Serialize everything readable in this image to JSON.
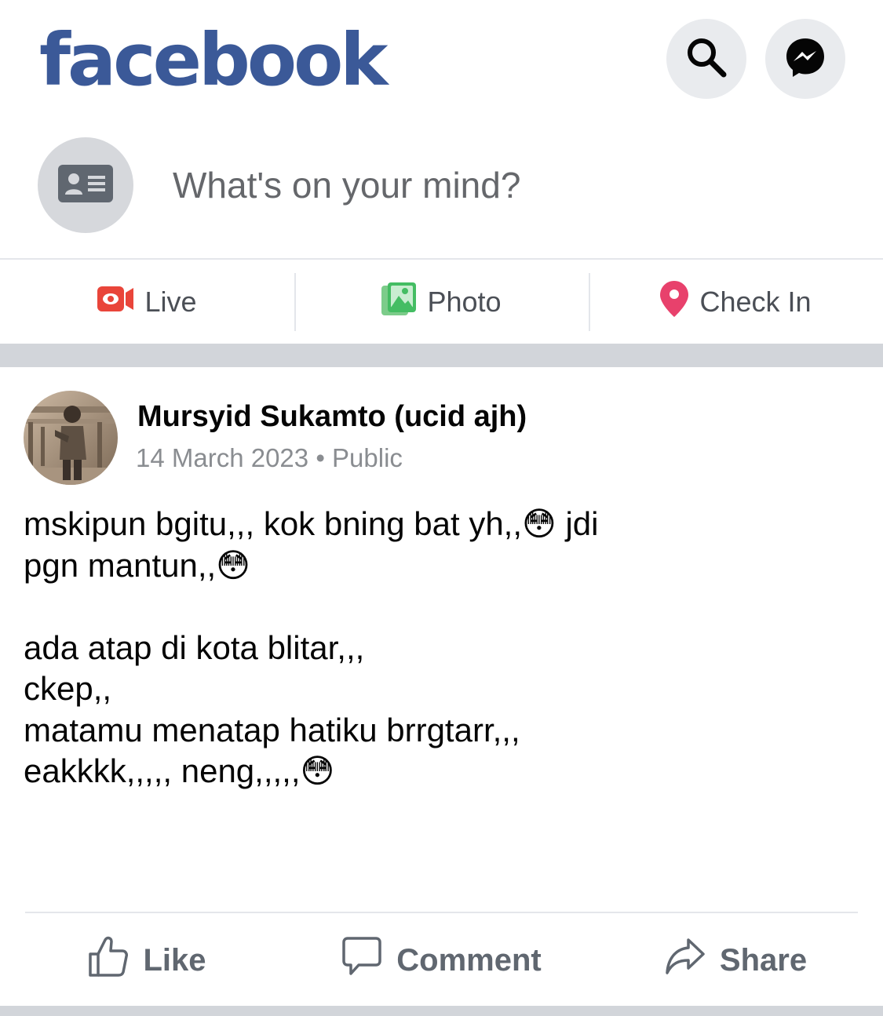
{
  "header": {
    "logo_text": "facebook",
    "brand_color": "#3b5998",
    "icons": [
      "search-icon",
      "messenger-icon"
    ]
  },
  "composer": {
    "placeholder": "What's on your mind?",
    "avatar_icon": "profile-card-icon"
  },
  "composer_actions": [
    {
      "label": "Live",
      "icon": "live-video-icon",
      "color": "#e9453a"
    },
    {
      "label": "Photo",
      "icon": "photo-icon",
      "color": "#44bd63"
    },
    {
      "label": "Check In",
      "icon": "location-pin-icon",
      "color": "#e8416c"
    }
  ],
  "post": {
    "author": "Mursyid Sukamto (ucid ajh)",
    "date": "14 March 2023",
    "separator": "•",
    "privacy": "Public",
    "body": "mskipun bgitu,,, kok bning bat yh,,😳 jdi\npgn mantun,,😳\n\nada atap di kota blitar,,,\nckep,,\nmatamu menatap hatiku brrgtarr,,,\neakkkk,,,,, neng,,,,,😳"
  },
  "post_actions": [
    {
      "label": "Like",
      "icon": "thumbs-up-icon"
    },
    {
      "label": "Comment",
      "icon": "comment-bubble-icon"
    },
    {
      "label": "Share",
      "icon": "share-arrow-icon"
    }
  ]
}
